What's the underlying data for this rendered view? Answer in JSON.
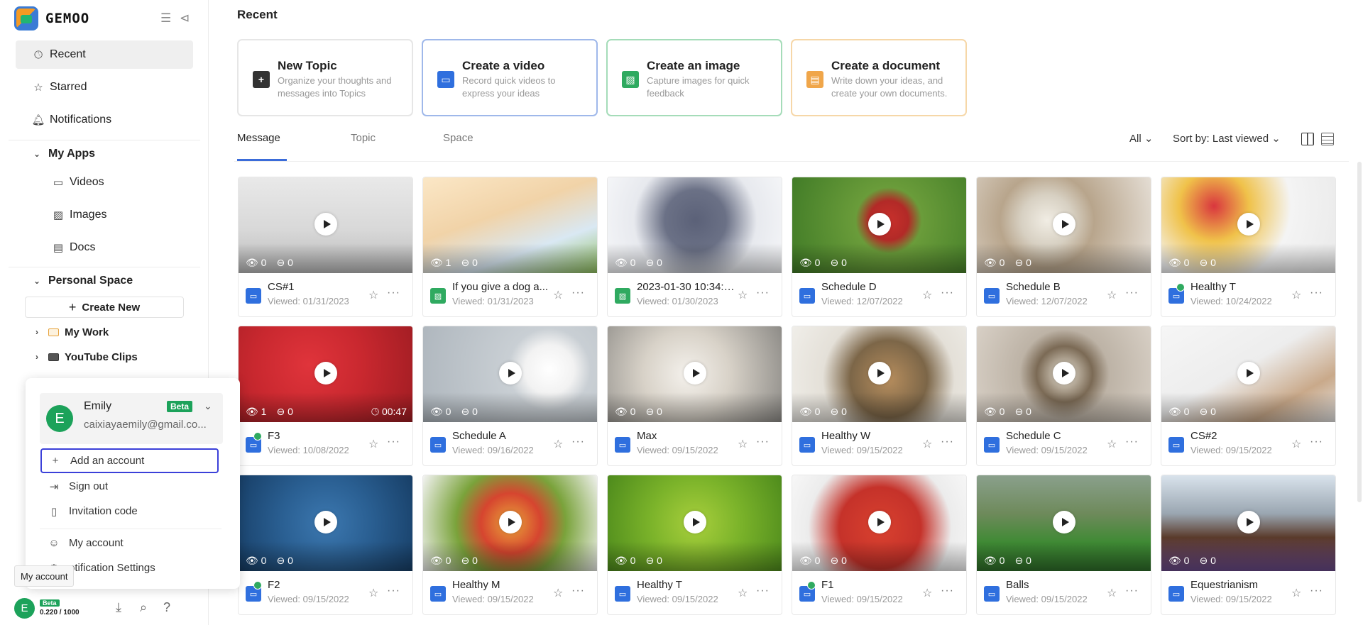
{
  "app": {
    "logo_text": "GEMOO"
  },
  "sidebar": {
    "items": [
      {
        "label": "Recent",
        "icon": "clock-icon"
      },
      {
        "label": "Starred",
        "icon": "star-icon"
      },
      {
        "label": "Notifications",
        "icon": "bell-icon"
      }
    ],
    "my_apps": {
      "label": "My Apps",
      "items": [
        {
          "label": "Videos",
          "icon": "video-icon"
        },
        {
          "label": "Images",
          "icon": "image-icon"
        },
        {
          "label": "Docs",
          "icon": "doc-icon"
        }
      ]
    },
    "personal_space": {
      "label": "Personal Space",
      "create_new": "Create New",
      "folders": [
        {
          "label": "My Work",
          "icon": "folder-icon"
        },
        {
          "label": "YouTube Clips",
          "icon": "folder-icon"
        }
      ]
    }
  },
  "account_menu": {
    "name": "Emily",
    "initial": "E",
    "badge": "Beta",
    "email": "caixiayaemily@gmail.co...",
    "items": [
      {
        "label": "Add an account",
        "icon": "plus-icon"
      },
      {
        "label": "Sign out",
        "icon": "sign-out-icon"
      },
      {
        "label": "Invitation code",
        "icon": "ticket-icon"
      },
      {
        "label": "My account",
        "icon": "smile-icon"
      },
      {
        "label": "otification Settings",
        "icon": "gear-icon"
      }
    ]
  },
  "tooltip": "My account",
  "bottom_bar": {
    "initial": "E",
    "badge": "Beta",
    "quota": "0.220 / 1000"
  },
  "main": {
    "title": "Recent",
    "quick_actions": [
      {
        "title": "New Topic",
        "desc": "Organize your thoughts and messages into Topics",
        "icon": "plus-icon",
        "color": "#333333",
        "border": "#e6e6e6"
      },
      {
        "title": "Create a video",
        "desc": "Record quick videos to express your ideas",
        "icon": "video-icon",
        "color": "#2f6fde",
        "border": "#9fb8ea"
      },
      {
        "title": "Create an image",
        "desc": "Capture images for quick feedback",
        "icon": "image-icon",
        "color": "#2faa60",
        "border": "#a5dcb9"
      },
      {
        "title": "Create a document",
        "desc": "Write down your ideas, and create your own documents.",
        "icon": "doc-icon",
        "color": "#f0a64a",
        "border": "#f6d7a8"
      }
    ],
    "tabs": [
      "Message",
      "Topic",
      "Space"
    ],
    "filter_label": "All",
    "sort_label": "Sort by: Last viewed",
    "cards": [
      {
        "name": "CS#1",
        "viewed": "Viewed: 01/31/2023",
        "type": "video",
        "views": "0",
        "comments": "0",
        "duration": "",
        "bg": "linear-gradient(180deg,#e9e9e9 0,#d8d8d8 55%,#b9b9b9 100%)",
        "badge": false
      },
      {
        "name": "If you give a dog a...",
        "viewed": "Viewed: 01/31/2023",
        "type": "image",
        "views": "1",
        "comments": "0",
        "duration": "",
        "bg": "linear-gradient(160deg,#fbe7c6 0,#f1d3a8 40%,#d9e8f3 70%,#8fbf5e 100%)",
        "badge": false
      },
      {
        "name": "2023-01-30 10:34:0...",
        "viewed": "Viewed: 01/30/2023",
        "type": "image",
        "views": "0",
        "comments": "0",
        "duration": "",
        "bg": "radial-gradient(circle at 50% 45%,#5b6178 0,#6b7186 30%,#e7e9ee 60%,#f6f7f9 100%)",
        "badge": false
      },
      {
        "name": "Schedule D",
        "viewed": "Viewed: 12/07/2022",
        "type": "video",
        "views": "0",
        "comments": "0",
        "duration": "",
        "bg": "radial-gradient(circle at 55% 45%,#c9302c 0,#b22a27 18%,#6a9c3a 30%,#3f7a26 100%)",
        "badge": false
      },
      {
        "name": "Schedule B",
        "viewed": "Viewed: 12/07/2022",
        "type": "video",
        "views": "0",
        "comments": "0",
        "duration": "",
        "bg": "radial-gradient(circle at 40% 45%,#f1ede4 0,#d7d0c2 22%,#b8a58c 40%,#e8e2da 100%)",
        "badge": false
      },
      {
        "name": "Healthy T",
        "viewed": "Viewed: 10/24/2022",
        "type": "video",
        "views": "0",
        "comments": "0",
        "duration": "",
        "bg": "radial-gradient(circle at 30% 30%,#d9363e 0,#f0c24a 25%,#f4f4f4 55%,#e9e9e9 100%)",
        "badge": true
      },
      {
        "name": "F3",
        "viewed": "Viewed: 10/08/2022",
        "type": "video",
        "views": "1",
        "comments": "0",
        "duration": "00:47",
        "bg": "radial-gradient(circle at 40% 40%,#e0343b 0,#c9282f 45%,#9e1c22 100%)",
        "badge": true
      },
      {
        "name": "Schedule A",
        "viewed": "Viewed: 09/16/2022",
        "type": "video",
        "views": "0",
        "comments": "0",
        "duration": "",
        "bg": "radial-gradient(circle at 72% 45%,#ffffff 0,#f2f2f2 18%,#c9cfd4 30%,#aeb6bd 100%)",
        "badge": false
      },
      {
        "name": "Max",
        "viewed": "Viewed: 09/15/2022",
        "type": "video",
        "views": "0",
        "comments": "0",
        "duration": "",
        "bg": "radial-gradient(circle at 45% 50%,#f4f1ec 0,#d8d2c8 40%,#8c8a86 100%)",
        "badge": false
      },
      {
        "name": "Healthy W",
        "viewed": "Viewed: 09/15/2022",
        "type": "video",
        "views": "0",
        "comments": "0",
        "duration": "",
        "bg": "radial-gradient(circle at 55% 55%,#b68d5d 0,#7c6648 35%,#e4e0d8 60%,#f0eee9 100%)",
        "badge": false
      },
      {
        "name": "Schedule C",
        "viewed": "Viewed: 09/15/2022",
        "type": "video",
        "views": "0",
        "comments": "0",
        "duration": "",
        "bg": "radial-gradient(circle at 50% 50%,#ece6d9 0,#7b6a55 28%,#bdb3a6 45%,#d8d0c6 100%)",
        "badge": false
      },
      {
        "name": "CS#2",
        "viewed": "Viewed: 09/15/2022",
        "type": "video",
        "views": "0",
        "comments": "0",
        "duration": "",
        "bg": "linear-gradient(150deg,#f6f6f6 0,#ededed 45%,#c9a98a 75%,#e8e8e8 100%)",
        "badge": false
      },
      {
        "name": "F2",
        "viewed": "Viewed: 09/15/2022",
        "type": "video",
        "views": "0",
        "comments": "0",
        "duration": "",
        "bg": "radial-gradient(circle at 50% 50%,#3c78b0 0,#2a5f92 45%,#173e66 100%)",
        "badge": true
      },
      {
        "name": "Healthy M",
        "viewed": "Viewed: 09/15/2022",
        "type": "video",
        "views": "0",
        "comments": "0",
        "duration": "",
        "bg": "radial-gradient(circle at 50% 50%,#e9a53a 0,#d6452f 30%,#7aa33b 55%,#f3f3f3 100%)",
        "badge": false
      },
      {
        "name": "Healthy T",
        "viewed": "Viewed: 09/15/2022",
        "type": "video",
        "views": "0",
        "comments": "0",
        "duration": "",
        "bg": "radial-gradient(circle at 50% 50%,#a8cf3c 0,#7bb32a 45%,#4d8a1c 100%)",
        "badge": false
      },
      {
        "name": "F1",
        "viewed": "Viewed: 09/15/2022",
        "type": "video",
        "views": "0",
        "comments": "0",
        "duration": "",
        "bg": "radial-gradient(circle at 50% 55%,#d9412f 0,#c5322a 40%,#ececec 70%,#f7f7f7 100%)",
        "badge": true
      },
      {
        "name": "Balls",
        "viewed": "Viewed: 09/15/2022",
        "type": "video",
        "views": "0",
        "comments": "0",
        "duration": "",
        "bg": "linear-gradient(180deg,#8aa08c 0,#6e8a5b 40%,#3f8a34 70%,#2f6e2a 100%)",
        "badge": false
      },
      {
        "name": "Equestrianism",
        "viewed": "Viewed: 09/15/2022",
        "type": "video",
        "views": "0",
        "comments": "0",
        "duration": "",
        "bg": "linear-gradient(180deg,#d9e3ec 0,#9aa6b1 40%,#5a3a2a 65%,#6a4a8a 100%)",
        "badge": false
      }
    ]
  }
}
